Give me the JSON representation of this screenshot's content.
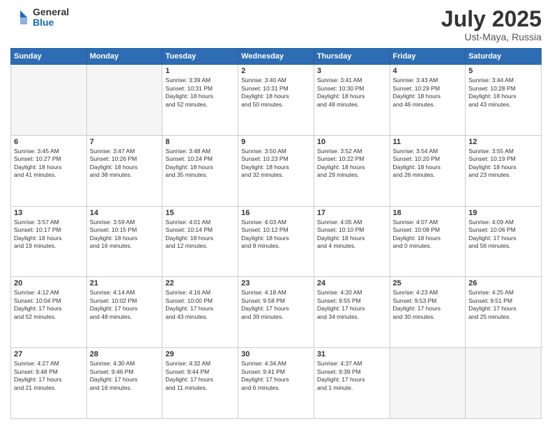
{
  "header": {
    "logo_general": "General",
    "logo_blue": "Blue",
    "title": "July 2025",
    "location": "Ust-Maya, Russia"
  },
  "days_of_week": [
    "Sunday",
    "Monday",
    "Tuesday",
    "Wednesday",
    "Thursday",
    "Friday",
    "Saturday"
  ],
  "weeks": [
    [
      {
        "day": "",
        "content": ""
      },
      {
        "day": "",
        "content": ""
      },
      {
        "day": "1",
        "content": "Sunrise: 3:39 AM\nSunset: 10:31 PM\nDaylight: 18 hours\nand 52 minutes."
      },
      {
        "day": "2",
        "content": "Sunrise: 3:40 AM\nSunset: 10:31 PM\nDaylight: 18 hours\nand 50 minutes."
      },
      {
        "day": "3",
        "content": "Sunrise: 3:41 AM\nSunset: 10:30 PM\nDaylight: 18 hours\nand 48 minutes."
      },
      {
        "day": "4",
        "content": "Sunrise: 3:43 AM\nSunset: 10:29 PM\nDaylight: 18 hours\nand 46 minutes."
      },
      {
        "day": "5",
        "content": "Sunrise: 3:44 AM\nSunset: 10:28 PM\nDaylight: 18 hours\nand 43 minutes."
      }
    ],
    [
      {
        "day": "6",
        "content": "Sunrise: 3:45 AM\nSunset: 10:27 PM\nDaylight: 18 hours\nand 41 minutes."
      },
      {
        "day": "7",
        "content": "Sunrise: 3:47 AM\nSunset: 10:26 PM\nDaylight: 18 hours\nand 38 minutes."
      },
      {
        "day": "8",
        "content": "Sunrise: 3:48 AM\nSunset: 10:24 PM\nDaylight: 18 hours\nand 35 minutes."
      },
      {
        "day": "9",
        "content": "Sunrise: 3:50 AM\nSunset: 10:23 PM\nDaylight: 18 hours\nand 32 minutes."
      },
      {
        "day": "10",
        "content": "Sunrise: 3:52 AM\nSunset: 10:22 PM\nDaylight: 18 hours\nand 29 minutes."
      },
      {
        "day": "11",
        "content": "Sunrise: 3:54 AM\nSunset: 10:20 PM\nDaylight: 18 hours\nand 26 minutes."
      },
      {
        "day": "12",
        "content": "Sunrise: 3:55 AM\nSunset: 10:19 PM\nDaylight: 18 hours\nand 23 minutes."
      }
    ],
    [
      {
        "day": "13",
        "content": "Sunrise: 3:57 AM\nSunset: 10:17 PM\nDaylight: 18 hours\nand 19 minutes."
      },
      {
        "day": "14",
        "content": "Sunrise: 3:59 AM\nSunset: 10:15 PM\nDaylight: 18 hours\nand 16 minutes."
      },
      {
        "day": "15",
        "content": "Sunrise: 4:01 AM\nSunset: 10:14 PM\nDaylight: 18 hours\nand 12 minutes."
      },
      {
        "day": "16",
        "content": "Sunrise: 4:03 AM\nSunset: 10:12 PM\nDaylight: 18 hours\nand 8 minutes."
      },
      {
        "day": "17",
        "content": "Sunrise: 4:05 AM\nSunset: 10:10 PM\nDaylight: 18 hours\nand 4 minutes."
      },
      {
        "day": "18",
        "content": "Sunrise: 4:07 AM\nSunset: 10:08 PM\nDaylight: 18 hours\nand 0 minutes."
      },
      {
        "day": "19",
        "content": "Sunrise: 4:09 AM\nSunset: 10:06 PM\nDaylight: 17 hours\nand 56 minutes."
      }
    ],
    [
      {
        "day": "20",
        "content": "Sunrise: 4:12 AM\nSunset: 10:04 PM\nDaylight: 17 hours\nand 52 minutes."
      },
      {
        "day": "21",
        "content": "Sunrise: 4:14 AM\nSunset: 10:02 PM\nDaylight: 17 hours\nand 48 minutes."
      },
      {
        "day": "22",
        "content": "Sunrise: 4:16 AM\nSunset: 10:00 PM\nDaylight: 17 hours\nand 43 minutes."
      },
      {
        "day": "23",
        "content": "Sunrise: 4:18 AM\nSunset: 9:58 PM\nDaylight: 17 hours\nand 39 minutes."
      },
      {
        "day": "24",
        "content": "Sunrise: 4:20 AM\nSunset: 9:55 PM\nDaylight: 17 hours\nand 34 minutes."
      },
      {
        "day": "25",
        "content": "Sunrise: 4:23 AM\nSunset: 9:53 PM\nDaylight: 17 hours\nand 30 minutes."
      },
      {
        "day": "26",
        "content": "Sunrise: 4:25 AM\nSunset: 9:51 PM\nDaylight: 17 hours\nand 25 minutes."
      }
    ],
    [
      {
        "day": "27",
        "content": "Sunrise: 4:27 AM\nSunset: 9:48 PM\nDaylight: 17 hours\nand 21 minutes."
      },
      {
        "day": "28",
        "content": "Sunrise: 4:30 AM\nSunset: 9:46 PM\nDaylight: 17 hours\nand 16 minutes."
      },
      {
        "day": "29",
        "content": "Sunrise: 4:32 AM\nSunset: 9:44 PM\nDaylight: 17 hours\nand 11 minutes."
      },
      {
        "day": "30",
        "content": "Sunrise: 4:34 AM\nSunset: 9:41 PM\nDaylight: 17 hours\nand 6 minutes."
      },
      {
        "day": "31",
        "content": "Sunrise: 4:37 AM\nSunset: 9:39 PM\nDaylight: 17 hours\nand 1 minute."
      },
      {
        "day": "",
        "content": ""
      },
      {
        "day": "",
        "content": ""
      }
    ]
  ]
}
